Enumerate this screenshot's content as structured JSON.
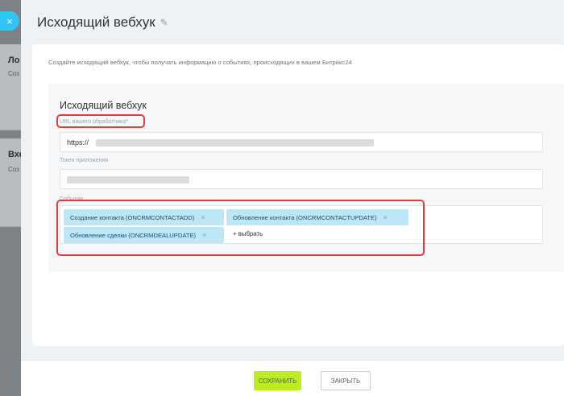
{
  "background": {
    "cards": [
      {
        "title": "Ло",
        "sub": "Соз"
      },
      {
        "title": "Вхо",
        "sub": "Соз"
      }
    ]
  },
  "close_glyph": "×",
  "slider": {
    "title": "Исходящий вебхук",
    "description": "Создайте исходящий вебхук, чтобы получать информацию о событиях, происходящих в вашем Битрикс24",
    "panel_title": "Исходящий вебхук",
    "url_label": "URL вашего обработчика*",
    "url_value": "https://",
    "token_label": "Токен приложения",
    "events_label": "События",
    "events": [
      {
        "label": "Создание контакта (ONCRMCONTACTADD)"
      },
      {
        "label": "Обновление контакта (ONCRMCONTACTUPDATE)"
      },
      {
        "label": "Обновление сделки (ONCRMDEALUPDATE)"
      }
    ],
    "add_event_label": "+ выбрать"
  },
  "footer": {
    "save_label": "СОХРАНИТЬ",
    "close_label": "ЗАКРЫТЬ"
  },
  "colors": {
    "accent_blue": "#2fc6f6",
    "save_green": "#bbed21",
    "highlight_red": "#e53b3b",
    "chip_blue": "#bde6f6"
  }
}
